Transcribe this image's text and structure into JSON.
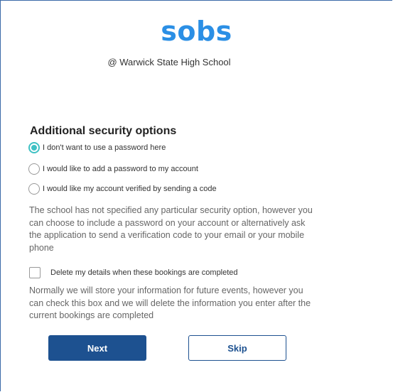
{
  "logo": "sobs",
  "school_line": "@ Warwick State High School",
  "section_title": "Additional security options",
  "options": [
    {
      "label": "I don't want to use a password here",
      "checked": true
    },
    {
      "label": "I would like to add a password to my account",
      "checked": false
    },
    {
      "label": "I would like my account verified by sending a code",
      "checked": false
    }
  ],
  "info_text": "The school has not specified any particular security option, however you can choose to include a password on your account or alternatively ask the application to send a verification code to your email or your mobile phone",
  "delete_checkbox": {
    "label": "Delete my details when these bookings are completed",
    "checked": false
  },
  "delete_info": "Normally we will store your information for future events, however you can check this box and we will delete the information you enter after the current bookings are completed",
  "buttons": {
    "next": "Next",
    "skip": "Skip"
  },
  "colors": {
    "brand": "#2b8fe5",
    "primary": "#1d5190",
    "radio_accent": "#3fc1c4"
  }
}
